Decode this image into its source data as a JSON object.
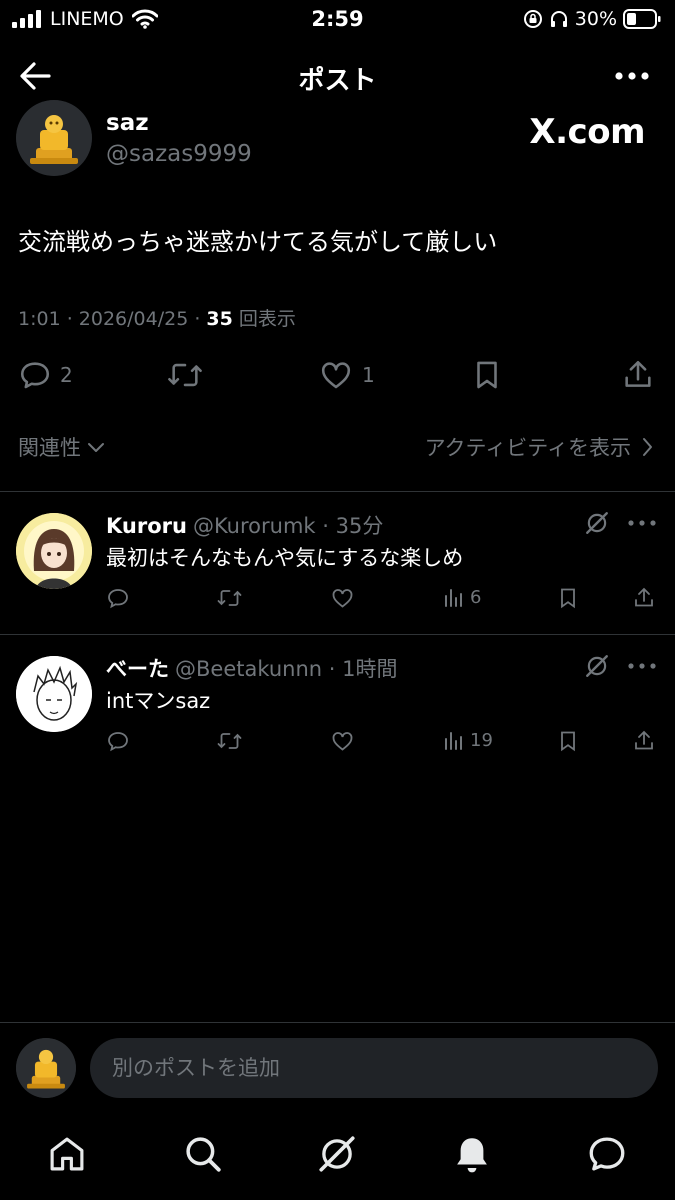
{
  "status": {
    "carrier": "LINEMO",
    "time": "2:59",
    "battery": "30%"
  },
  "header": {
    "title": "ポスト"
  },
  "post": {
    "name": "saz",
    "handle": "@sazas9999",
    "watermark": "X.com",
    "text": "交流戦めっちゃ迷惑かけてる気がして厳しい",
    "timestamp": "1:01 · 2026/04/25 · ",
    "views_count": "35",
    "views_label": "回表示",
    "replies": "2",
    "reposts": "",
    "likes": "1"
  },
  "sort": {
    "label": "関連性",
    "activity": "アクティビティを表示"
  },
  "replies": [
    {
      "name": "Kuroru",
      "meta": "@Kurorumk · 35分",
      "text": "最初はそんなもんや気にするな楽しめ",
      "views": "6"
    },
    {
      "name": "べーた",
      "meta": "@Beetakunnn · 1時間",
      "text": "intマンsaz",
      "views": "19"
    }
  ],
  "compose": {
    "placeholder": "別のポストを追加"
  },
  "icons": [
    "back-arrow-icon",
    "more-icon",
    "reply-icon",
    "repost-icon",
    "like-icon",
    "bookmark-icon",
    "share-icon",
    "views-icon",
    "grok-icon",
    "home-icon",
    "search-icon",
    "notifications-icon",
    "messages-icon"
  ],
  "colors": {
    "background": "#000000",
    "muted": "#71767b",
    "text": "#e7e9ea",
    "divider": "#2f3336",
    "input": "#202327"
  }
}
